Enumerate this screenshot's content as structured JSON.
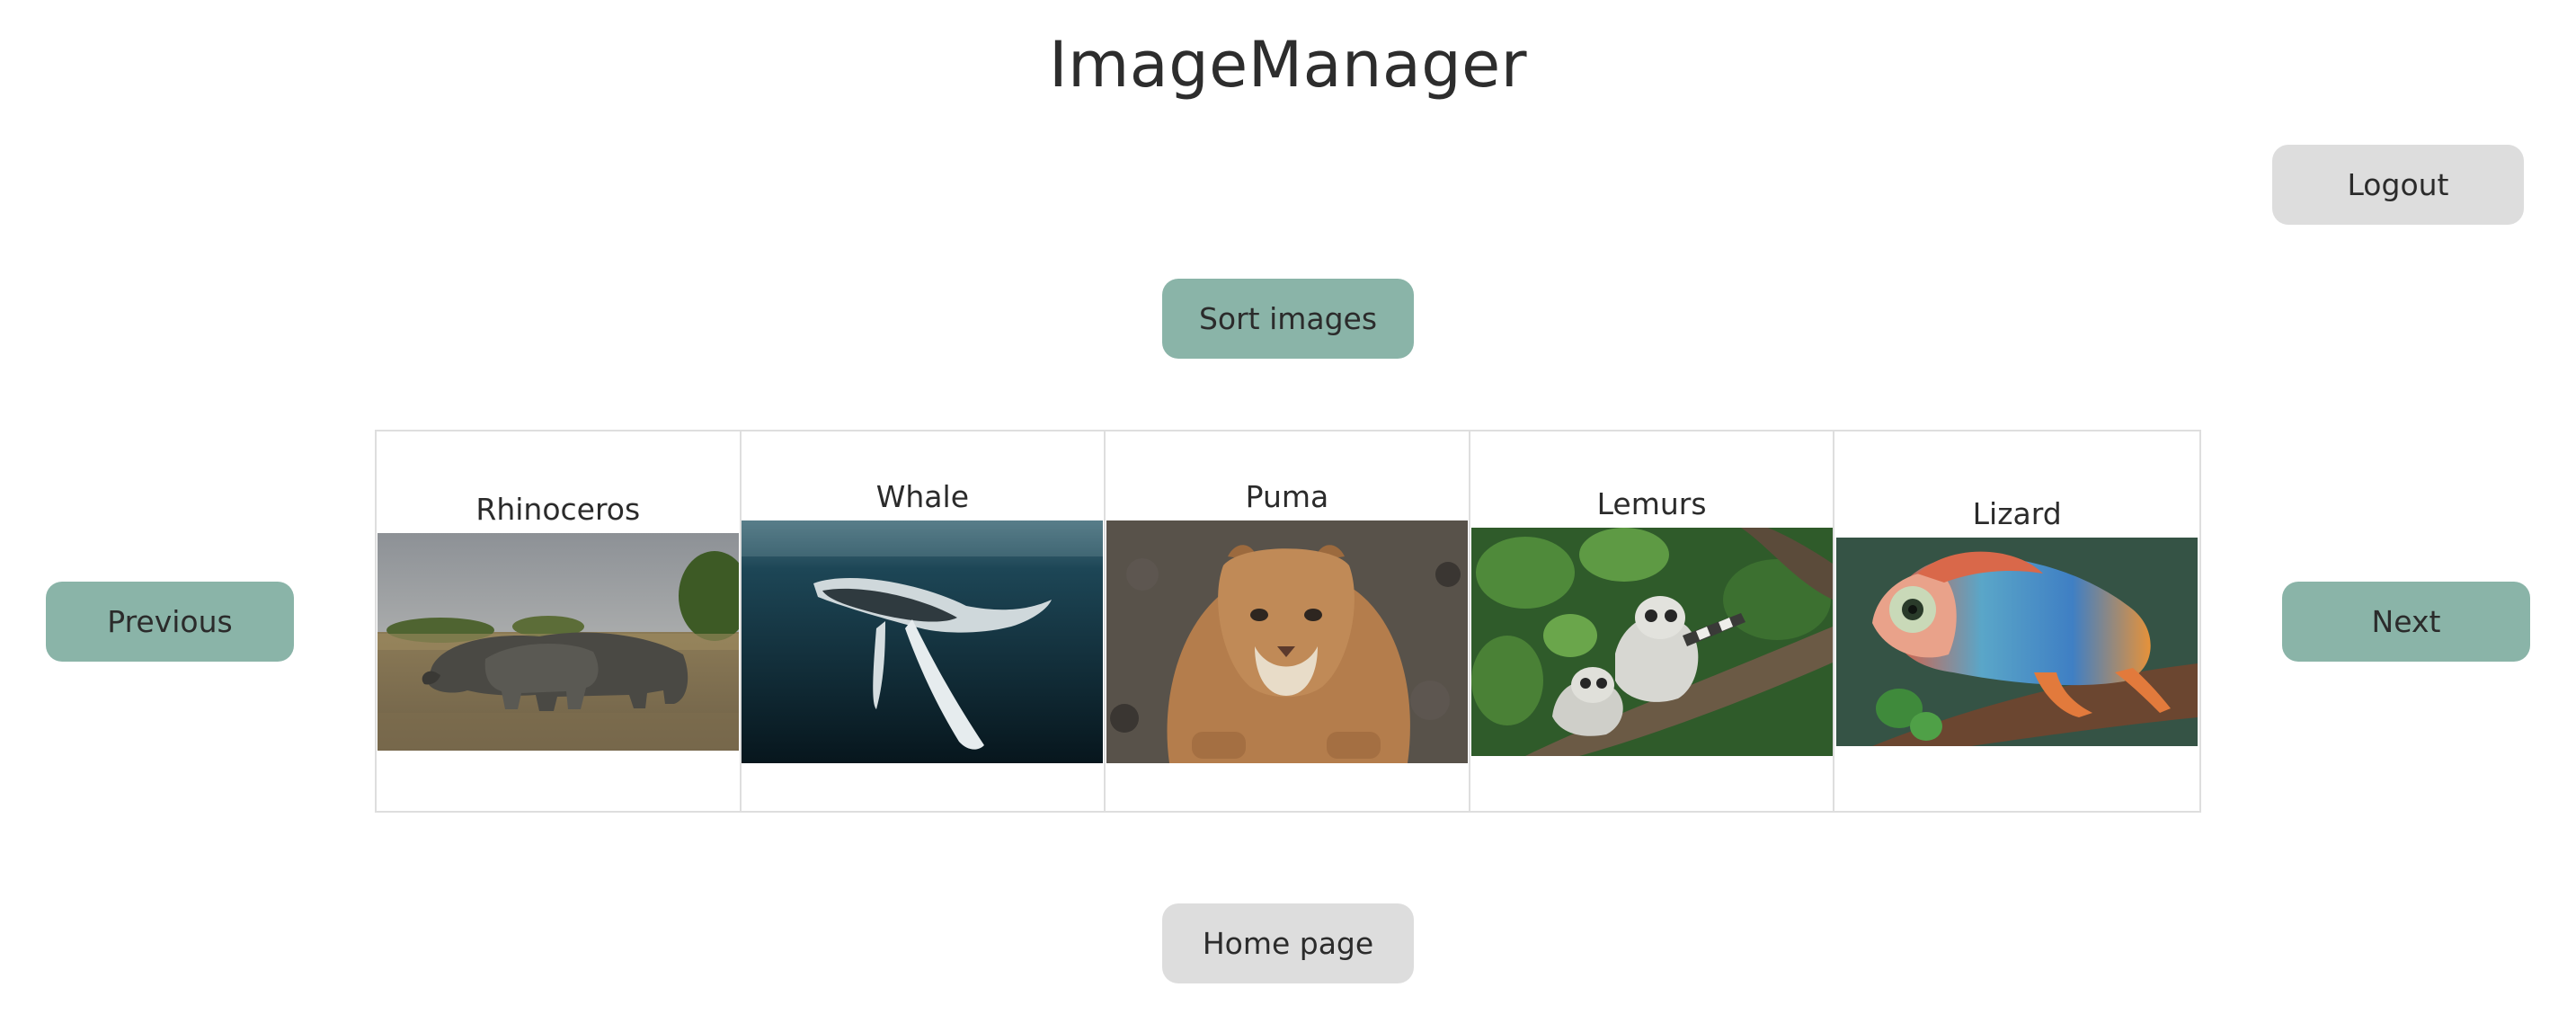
{
  "header": {
    "title": "ImageManager"
  },
  "actions": {
    "logout_label": "Logout",
    "sort_label": "Sort images",
    "home_label": "Home page"
  },
  "pager": {
    "previous_label": "Previous",
    "next_label": "Next"
  },
  "gallery": {
    "items": [
      {
        "label": "Rhinoceros",
        "subject": "rhinoceros-photo"
      },
      {
        "label": "Whale",
        "subject": "whale-photo"
      },
      {
        "label": "Puma",
        "subject": "puma-photo"
      },
      {
        "label": "Lemurs",
        "subject": "lemurs-photo"
      },
      {
        "label": "Lizard",
        "subject": "lizard-photo"
      }
    ]
  },
  "colors": {
    "teal_button": "#8ab4a8",
    "gray_button": "#dddddd",
    "border": "#dedede"
  }
}
